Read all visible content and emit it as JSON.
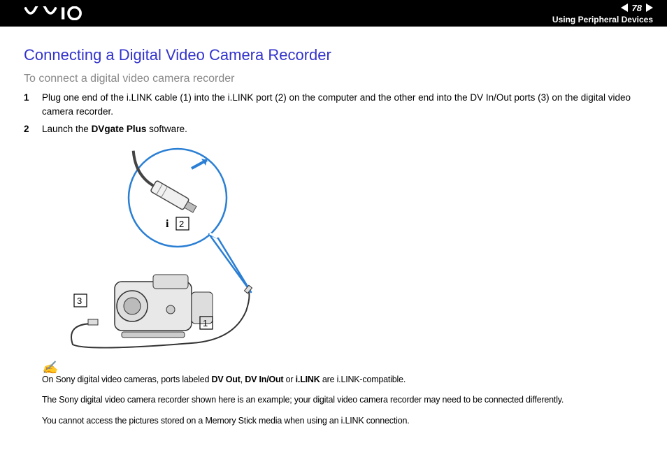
{
  "header": {
    "page_number": "78",
    "section": "Using Peripheral Devices"
  },
  "title": "Connecting a Digital Video Camera Recorder",
  "subtitle": "To connect a digital video camera recorder",
  "steps": [
    {
      "num": "1",
      "text_a": "Plug one end of the i.LINK cable (1) into the i.LINK port (2) on the computer and the other end into the DV In/Out ports (3) on the digital video camera recorder."
    },
    {
      "num": "2",
      "text_a": "Launch the ",
      "bold": "DVgate Plus",
      "text_b": " software."
    }
  ],
  "notes": {
    "line1_a": "On Sony digital video cameras, ports labeled ",
    "line1_b": "DV Out",
    "line1_c": ", ",
    "line1_d": "DV In/Out",
    "line1_e": " or ",
    "line1_f": "i.LINK",
    "line1_g": " are i.LINK-compatible.",
    "line2": "The Sony digital video camera recorder shown here is an example; your digital video camera recorder may need to be connected differently.",
    "line3": "You cannot access the pictures stored on a Memory Stick media when using an i.LINK connection."
  },
  "diagram_labels": {
    "l1": "1",
    "l2": "2",
    "l3": "3"
  }
}
